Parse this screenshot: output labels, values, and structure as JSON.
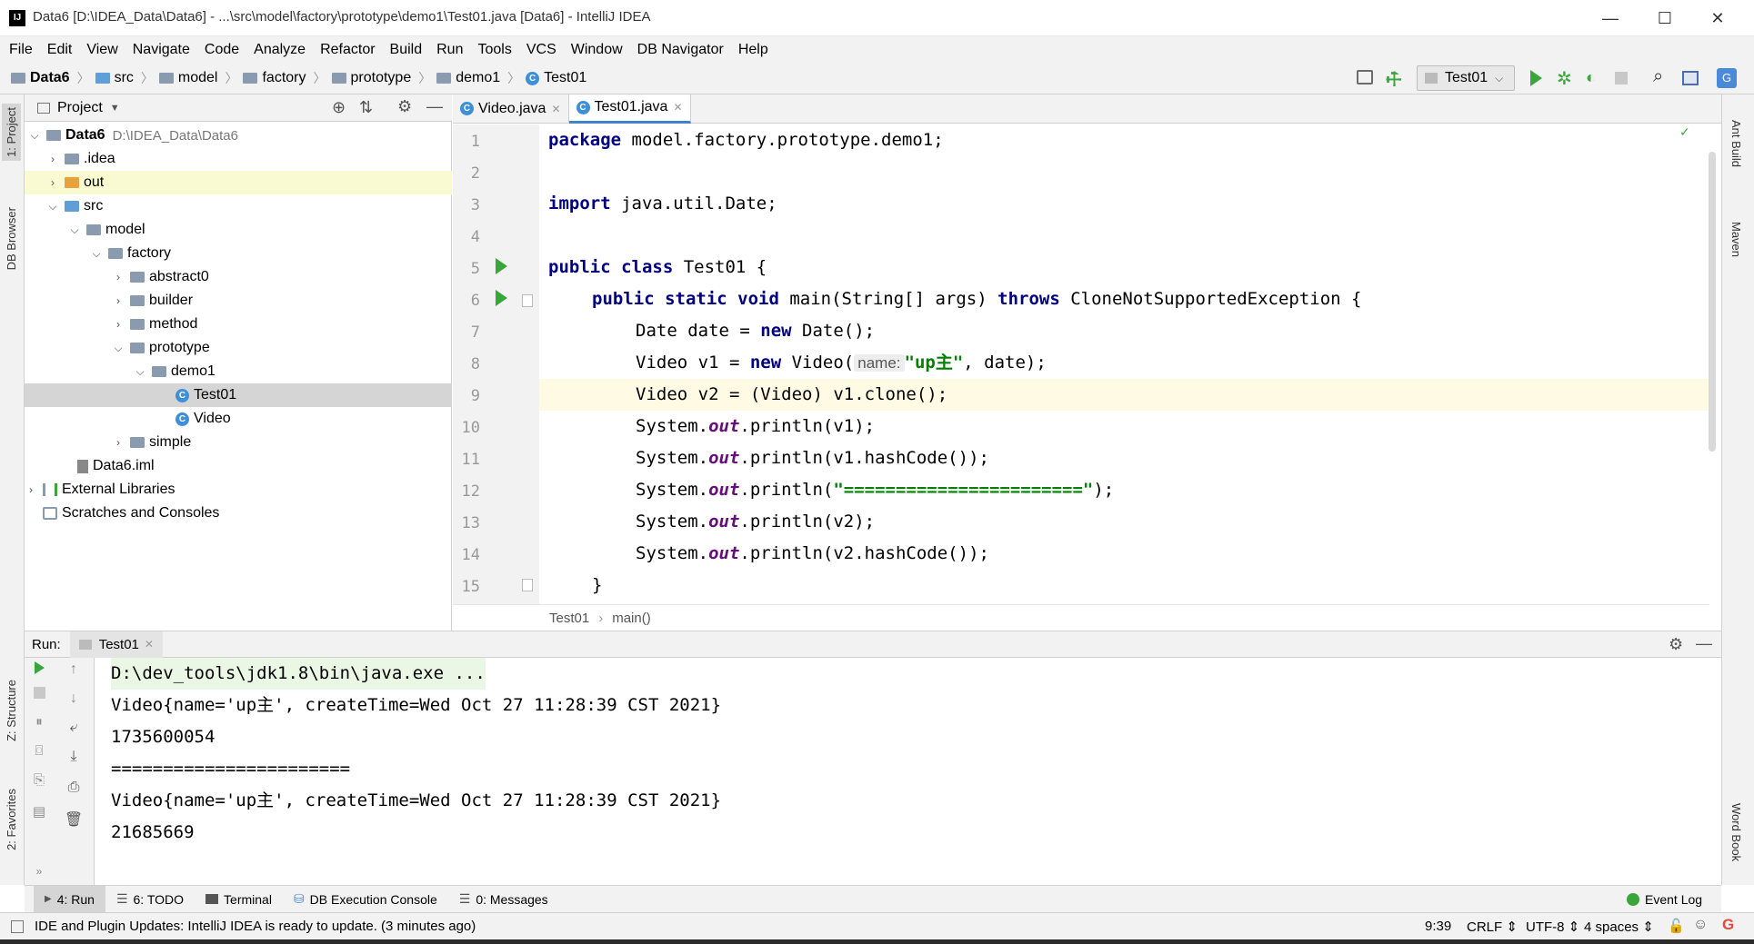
{
  "window": {
    "title": "Data6 [D:\\IDEA_Data\\Data6] - ...\\src\\model\\factory\\prototype\\demo1\\Test01.java [Data6] - IntelliJ IDEA",
    "logo": "IJ",
    "minimize": "—",
    "maximize": "☐",
    "close": "✕"
  },
  "menu": [
    "File",
    "Edit",
    "View",
    "Navigate",
    "Code",
    "Analyze",
    "Refactor",
    "Build",
    "Run",
    "Tools",
    "VCS",
    "Window",
    "DB Navigator",
    "Help"
  ],
  "breadcrumb": [
    "Data6",
    "src",
    "model",
    "factory",
    "prototype",
    "demo1",
    "Test01"
  ],
  "run_config": "Test01",
  "left_strip": {
    "project": "1: Project",
    "db_browser": "DB Browser",
    "structure": "Z: Structure",
    "favorites": "2: Favorites"
  },
  "right_strip": {
    "ant": "Ant Build",
    "maven": "Maven",
    "wordbook": "Word Book"
  },
  "project_panel": {
    "title": "Project",
    "tree": [
      {
        "label": "Data6",
        "path": "D:\\IDEA_Data\\Data6"
      },
      {
        "label": ".idea"
      },
      {
        "label": "out"
      },
      {
        "label": "src"
      },
      {
        "label": "model"
      },
      {
        "label": "factory"
      },
      {
        "label": "abstract0"
      },
      {
        "label": "builder"
      },
      {
        "label": "method"
      },
      {
        "label": "prototype"
      },
      {
        "label": "demo1"
      },
      {
        "label": "Test01"
      },
      {
        "label": "Video"
      },
      {
        "label": "simple"
      },
      {
        "label": "Data6.iml"
      },
      {
        "label": "External Libraries"
      },
      {
        "label": "Scratches and Consoles"
      }
    ]
  },
  "editor": {
    "tabs": [
      {
        "label": "Video.java"
      },
      {
        "label": "Test01.java"
      }
    ],
    "line_numbers": [
      "1",
      "2",
      "3",
      "4",
      "5",
      "6",
      "7",
      "8",
      "9",
      "10",
      "11",
      "12",
      "13",
      "14",
      "15"
    ],
    "lines": {
      "l1a": "package",
      "l1b": " model.factory.prototype.demo1;",
      "l3a": "import",
      "l3b": " java.util.Date;",
      "l5a": "public class",
      "l5b": " Test01 {",
      "l6a": "public static void",
      "l6b": " main(String[] args) ",
      "l6c": "throws",
      "l6d": " CloneNotSupportedException {",
      "l7a": "Date date = ",
      "l7b": "new",
      "l7c": " Date();",
      "l8a": "Video v1 = ",
      "l8b": "new",
      "l8c": " Video(",
      "l8hint": "name:",
      "l8d": "\"up主\"",
      "l8e": ", date);",
      "l9": "Video v2 = (Video) v1.clone();",
      "sys": "System.",
      "out": "out",
      "l10": ".println(v1);",
      "l11": ".println(v1.hashCode());",
      "l12a": ".println(",
      "l12b": "\"=======================\"",
      "l12c": ");",
      "l13": ".println(v2);",
      "l14": ".println(v2.hashCode());",
      "l15": "}"
    },
    "crumb_class": "Test01",
    "crumb_method": "main()"
  },
  "run_panel": {
    "label": "Run:",
    "tab": "Test01",
    "output": [
      "D:\\dev_tools\\jdk1.8\\bin\\java.exe ...",
      "Video{name='up主', createTime=Wed Oct 27 11:28:39 CST 2021}",
      "1735600054",
      "=======================",
      "Video{name='up主', createTime=Wed Oct 27 11:28:39 CST 2021}",
      "21685669"
    ]
  },
  "bottom_tabs": [
    "4: Run",
    "6: TODO",
    "Terminal",
    "DB Execution Console",
    "0: Messages"
  ],
  "event_log": "Event Log",
  "status": {
    "message": "IDE and Plugin Updates: IntelliJ IDEA is ready to update. (3 minutes ago)",
    "position": "9:39",
    "line_sep": "CRLF",
    "encoding": "UTF-8",
    "indent": "4 spaces"
  }
}
